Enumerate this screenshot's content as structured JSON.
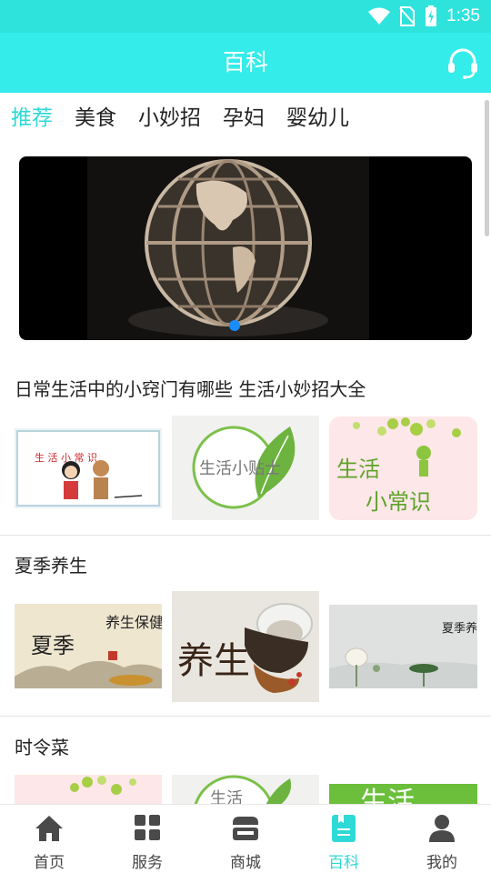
{
  "status_bar": {
    "time": "1:35",
    "icons": [
      "wifi-icon",
      "no-sim-icon",
      "battery-charging-icon"
    ]
  },
  "app_bar": {
    "title": "百科",
    "action_icon": "headset-icon"
  },
  "tabs": [
    {
      "label": "推荐",
      "active": true
    },
    {
      "label": "美食",
      "active": false
    },
    {
      "label": "小妙招",
      "active": false
    },
    {
      "label": "孕妇",
      "active": false
    },
    {
      "label": "婴幼儿",
      "active": false
    }
  ],
  "banner": {
    "image": "globe-sculpture",
    "page_count": 1,
    "current_page": 1
  },
  "sections": [
    {
      "title": "日常生活中的小窍门有哪些 生活小妙招大全",
      "thumbnails": [
        {
          "image": "cartoon-couple",
          "caption": "生 活 小 常 识"
        },
        {
          "image": "leaf-circle",
          "caption": "生活小贴士"
        },
        {
          "image": "green-bulbs",
          "caption_line1": "生活",
          "caption_line2": "小常识"
        }
      ]
    },
    {
      "title": "夏季养生",
      "thumbnails": [
        {
          "image": "calligraphy-landscape",
          "caption_main": "夏季",
          "caption_side": "养生保健"
        },
        {
          "image": "herbs-calligraphy",
          "caption": "养生"
        },
        {
          "image": "lotus-ink",
          "caption": "夏季养生"
        }
      ]
    },
    {
      "title": "时令菜",
      "thumbnails": [
        {
          "image": "green-bulbs"
        },
        {
          "image": "leaf-circle",
          "caption": "生活"
        },
        {
          "image": "green-banner",
          "caption": "生活"
        }
      ]
    }
  ],
  "colors": {
    "accent": "#34ecea",
    "active": "#2fd9d6",
    "banner_dot": "#1a8cff"
  },
  "bottom_nav": [
    {
      "label": "首页",
      "icon": "home-icon",
      "active": false
    },
    {
      "label": "服务",
      "icon": "grid-icon",
      "active": false
    },
    {
      "label": "商城",
      "icon": "store-icon",
      "active": false
    },
    {
      "label": "百科",
      "icon": "book-icon",
      "active": true
    },
    {
      "label": "我的",
      "icon": "person-icon",
      "active": false
    }
  ]
}
